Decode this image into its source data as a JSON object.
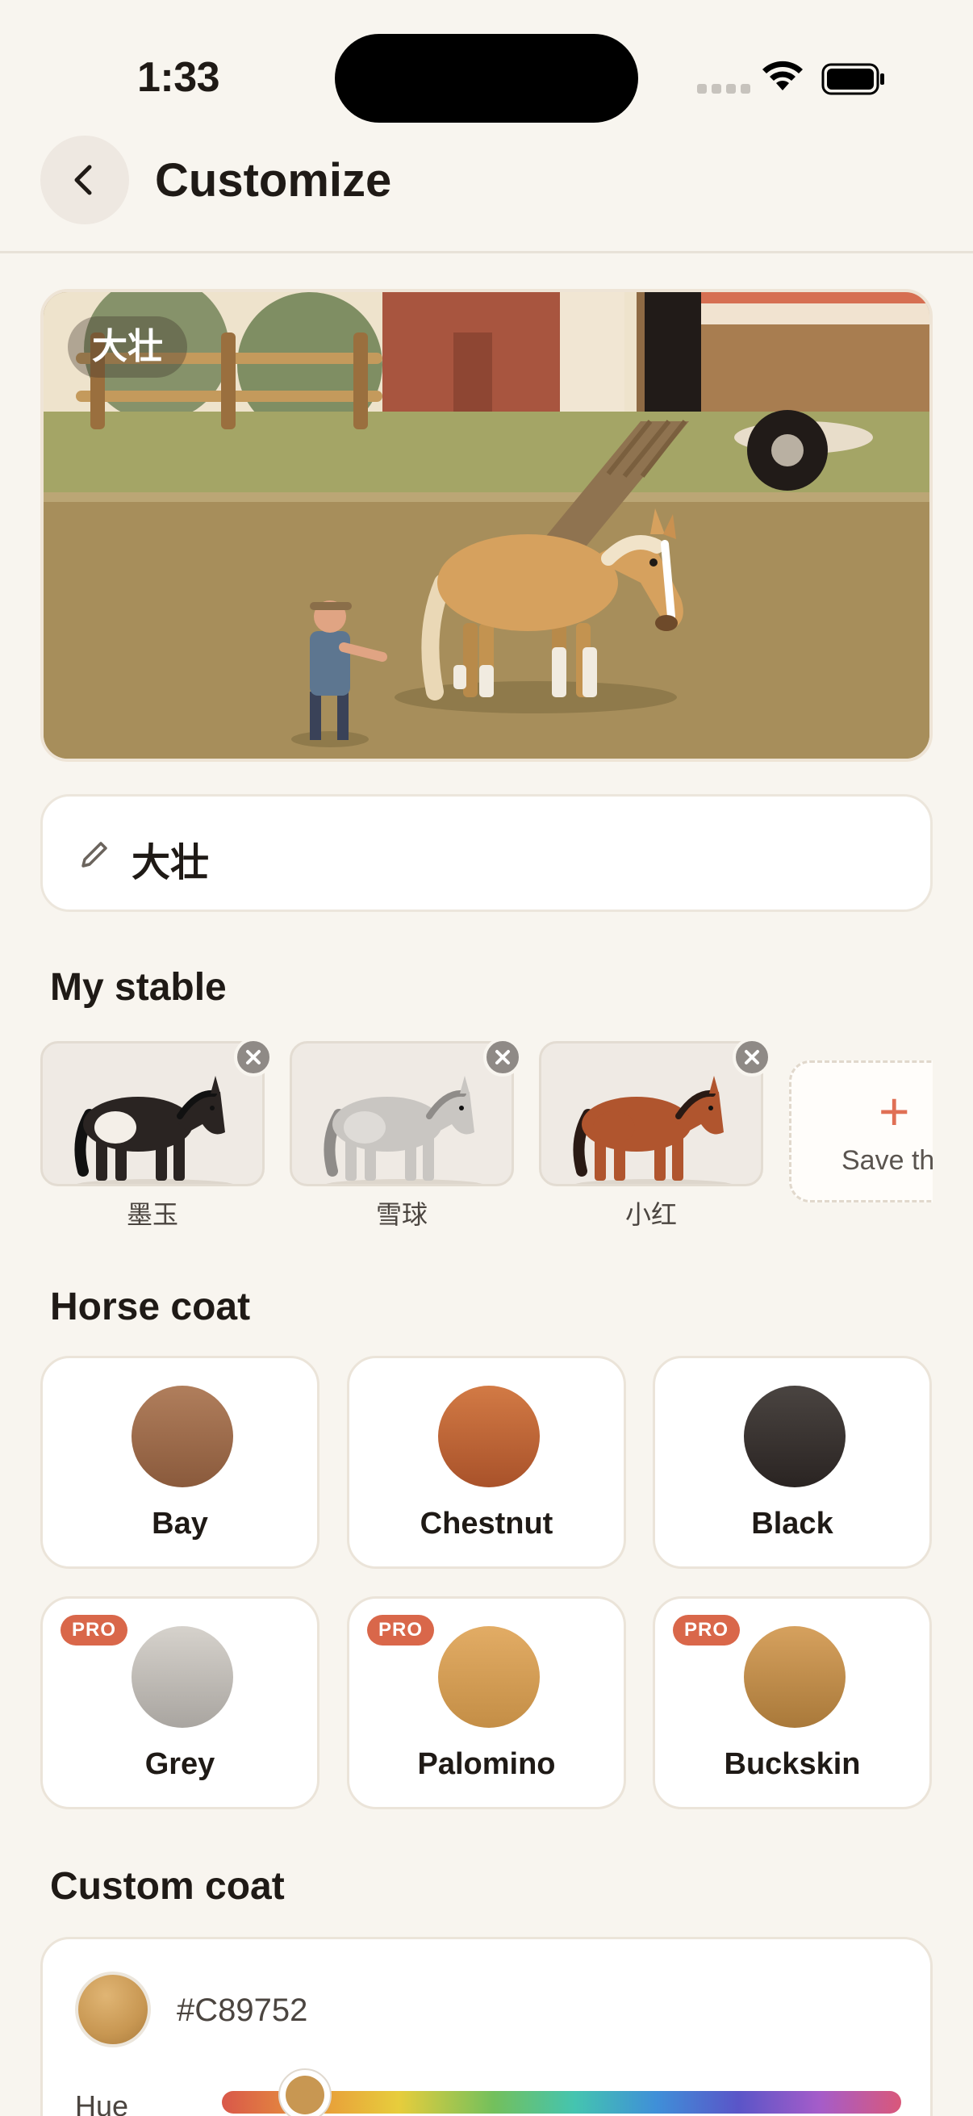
{
  "status_bar": {
    "time": "1:33"
  },
  "header": {
    "title": "Customize"
  },
  "hero": {
    "horse_name": "大壮"
  },
  "name_field": {
    "value": "大壮"
  },
  "stable": {
    "title": "My stable",
    "horses": [
      {
        "name": "墨玉",
        "colors": {
          "body": "#2a2422",
          "patch": "#f4efe8",
          "mane": "#111111"
        }
      },
      {
        "name": "雪球",
        "colors": {
          "body": "#c9c6c2",
          "patch": "#dedbd7",
          "mane": "#8f8c89"
        }
      },
      {
        "name": "小红",
        "colors": {
          "body": "#b0552e",
          "patch": "#b0552e",
          "mane": "#2a1a14"
        }
      }
    ],
    "save_label": "Save th"
  },
  "coats": {
    "title": "Horse coat",
    "pro_label": "PRO",
    "items": [
      {
        "name": "Bay",
        "color_top": "#b07e5c",
        "color_bottom": "#8a5a3c",
        "pro": false
      },
      {
        "name": "Chestnut",
        "color_top": "#d27a45",
        "color_bottom": "#a9522a",
        "pro": false
      },
      {
        "name": "Black",
        "color_top": "#4a4441",
        "color_bottom": "#2a2422",
        "pro": false
      },
      {
        "name": "Grey",
        "color_top": "#d6d2cc",
        "color_bottom": "#a9a5a0",
        "pro": true
      },
      {
        "name": "Palomino",
        "color_top": "#e2ac65",
        "color_bottom": "#c48e46",
        "pro": true
      },
      {
        "name": "Buckskin",
        "color_top": "#d6a15e",
        "color_bottom": "#a9793a",
        "pro": true
      }
    ]
  },
  "custom_coat": {
    "title": "Custom coat",
    "hex": "#C89752",
    "color": "#C89752",
    "hue_label": "Hue"
  }
}
